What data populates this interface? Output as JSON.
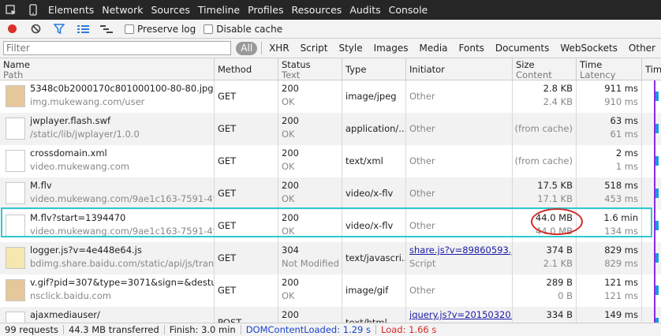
{
  "tabs": [
    "Elements",
    "Network",
    "Sources",
    "Timeline",
    "Profiles",
    "Resources",
    "Audits",
    "Console"
  ],
  "toolbar": {
    "preserve_log": "Preserve log",
    "disable_cache": "Disable cache"
  },
  "filter": {
    "placeholder": "Filter",
    "types": [
      "All",
      "XHR",
      "Script",
      "Style",
      "Images",
      "Media",
      "Fonts",
      "Documents",
      "WebSockets",
      "Other"
    ]
  },
  "columns": {
    "name": [
      "Name",
      "Path"
    ],
    "method": "Method",
    "status": [
      "Status",
      "Text"
    ],
    "type": "Type",
    "initiator": "Initiator",
    "size": [
      "Size",
      "Content"
    ],
    "time": [
      "Time",
      "Latency"
    ],
    "timeline": "Time"
  },
  "rows": [
    {
      "name": "5348c0b2000170c801000100-80-80.jpg",
      "path": "img.mukewang.com/user",
      "method": "GET",
      "status": "200",
      "status_text": "OK",
      "type": "image/jpeg",
      "initiator": "Other",
      "initiator_sub": "",
      "size": "2.8 KB",
      "content": "2.4 KB",
      "time": "911 ms",
      "latency": "910 ms",
      "icon": "image-thumb-icon"
    },
    {
      "name": "jwplayer.flash.swf",
      "path": "/static/lib/jwplayer/1.0.0",
      "method": "GET",
      "status": "200",
      "status_text": "OK",
      "type": "application/...",
      "initiator": "Other",
      "initiator_sub": "",
      "size": "(from cache)",
      "content": "",
      "time": "63 ms",
      "latency": "61 ms",
      "icon": "file-icon"
    },
    {
      "name": "crossdomain.xml",
      "path": "video.mukewang.com",
      "method": "GET",
      "status": "200",
      "status_text": "OK",
      "type": "text/xml",
      "initiator": "Other",
      "initiator_sub": "",
      "size": "(from cache)",
      "content": "",
      "time": "2 ms",
      "latency": "1 ms",
      "icon": "file-icon"
    },
    {
      "name": "M.flv",
      "path": "video.mukewang.com/9ae1c163-7591-4f...",
      "method": "GET",
      "status": "200",
      "status_text": "OK",
      "type": "video/x-flv",
      "initiator": "Other",
      "initiator_sub": "",
      "size": "17.5 KB",
      "content": "17.1 KB",
      "time": "518 ms",
      "latency": "453 ms",
      "icon": "file-icon"
    },
    {
      "name": "M.flv?start=1394470",
      "path": "video.mukewang.com/9ae1c163-7591-4f...",
      "method": "GET",
      "status": "200",
      "status_text": "OK",
      "type": "video/x-flv",
      "initiator": "Other",
      "initiator_sub": "",
      "size": "44.0 MB",
      "content": "44.0 MB",
      "time": "1.6 min",
      "latency": "134 ms",
      "icon": "file-icon"
    },
    {
      "name": "logger.js?v=4e448e64.js",
      "path": "bdimg.share.baidu.com/static/api/js/trans",
      "method": "GET",
      "status": "304",
      "status_text": "Not Modified",
      "type": "text/javascri...",
      "initiator": "share.js?v=89860593.j...",
      "initiator_sub": "Script",
      "size": "374 B",
      "content": "2.1 KB",
      "time": "829 ms",
      "latency": "829 ms",
      "icon": "js-file-icon"
    },
    {
      "name": "v.gif?pid=307&type=3071&sign=&desturl...",
      "path": "nsclick.baidu.com",
      "method": "GET",
      "status": "200",
      "status_text": "OK",
      "type": "image/gif",
      "initiator": "Other",
      "initiator_sub": "",
      "size": "289 B",
      "content": "0 B",
      "time": "121 ms",
      "latency": "121 ms",
      "icon": "image-thumb-icon"
    },
    {
      "name": "ajaxmediauser/",
      "path": "",
      "method": "POST",
      "status": "200",
      "status_text": "",
      "type": "text/html",
      "initiator": "jquery.js?v=20150320...",
      "initiator_sub": "",
      "size": "334 B",
      "content": "",
      "time": "149 ms",
      "latency": "",
      "icon": "file-icon"
    }
  ],
  "status": {
    "requests": "99 requests",
    "transferred": "44.3 MB transferred",
    "finish": "Finish: 3.0 min",
    "dcl": "DOMContentLoaded: 1.29 s",
    "load": "Load: 1.66 s"
  },
  "colors": {
    "record": "#d9302a",
    "accent_blue": "#2a7de1",
    "selection": "#2ec8d0",
    "highlight_oval": "#d42a2a"
  }
}
